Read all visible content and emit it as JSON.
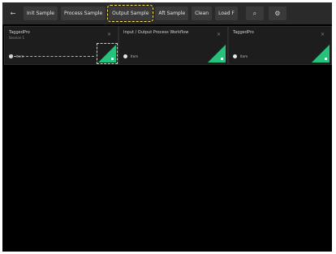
{
  "toolbar": {
    "back_icon": "back-arrow-icon",
    "buttons": [
      {
        "label": "Init Sample"
      },
      {
        "label": "Process Sample"
      },
      {
        "label": "Output Sample"
      },
      {
        "label": "Aft Sample"
      },
      {
        "label": "Clean"
      },
      {
        "label": "Load F"
      }
    ],
    "search_icon": "search-icon",
    "settings_icon": "gear-icon"
  },
  "cards": [
    {
      "title": "TaggedPro",
      "subtitle": "Session 1",
      "user": "Item"
    },
    {
      "title": "Input / Output Process Workflow",
      "subtitle": "",
      "user": "Item"
    },
    {
      "title": "TaggedPro",
      "subtitle": "",
      "user": "Item"
    }
  ],
  "colors": {
    "accent_green": "#25c27c",
    "background": "#000000",
    "toolbar": "#2a2a2a",
    "highlight_yellow": "#ffe45c"
  }
}
